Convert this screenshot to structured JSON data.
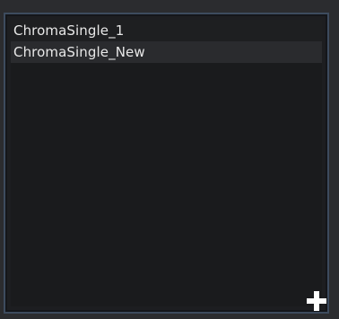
{
  "list": {
    "items": [
      {
        "label": "ChromaSingle_1"
      },
      {
        "label": "ChromaSingle_New"
      }
    ]
  },
  "add_button": {
    "icon": "plus-icon"
  },
  "colors": {
    "background": "#2b2c2f",
    "panel": "#1a1b1d",
    "border": "#3d4b5e",
    "text": "#e8e8e8",
    "selected_row": "#2a2b2e"
  }
}
